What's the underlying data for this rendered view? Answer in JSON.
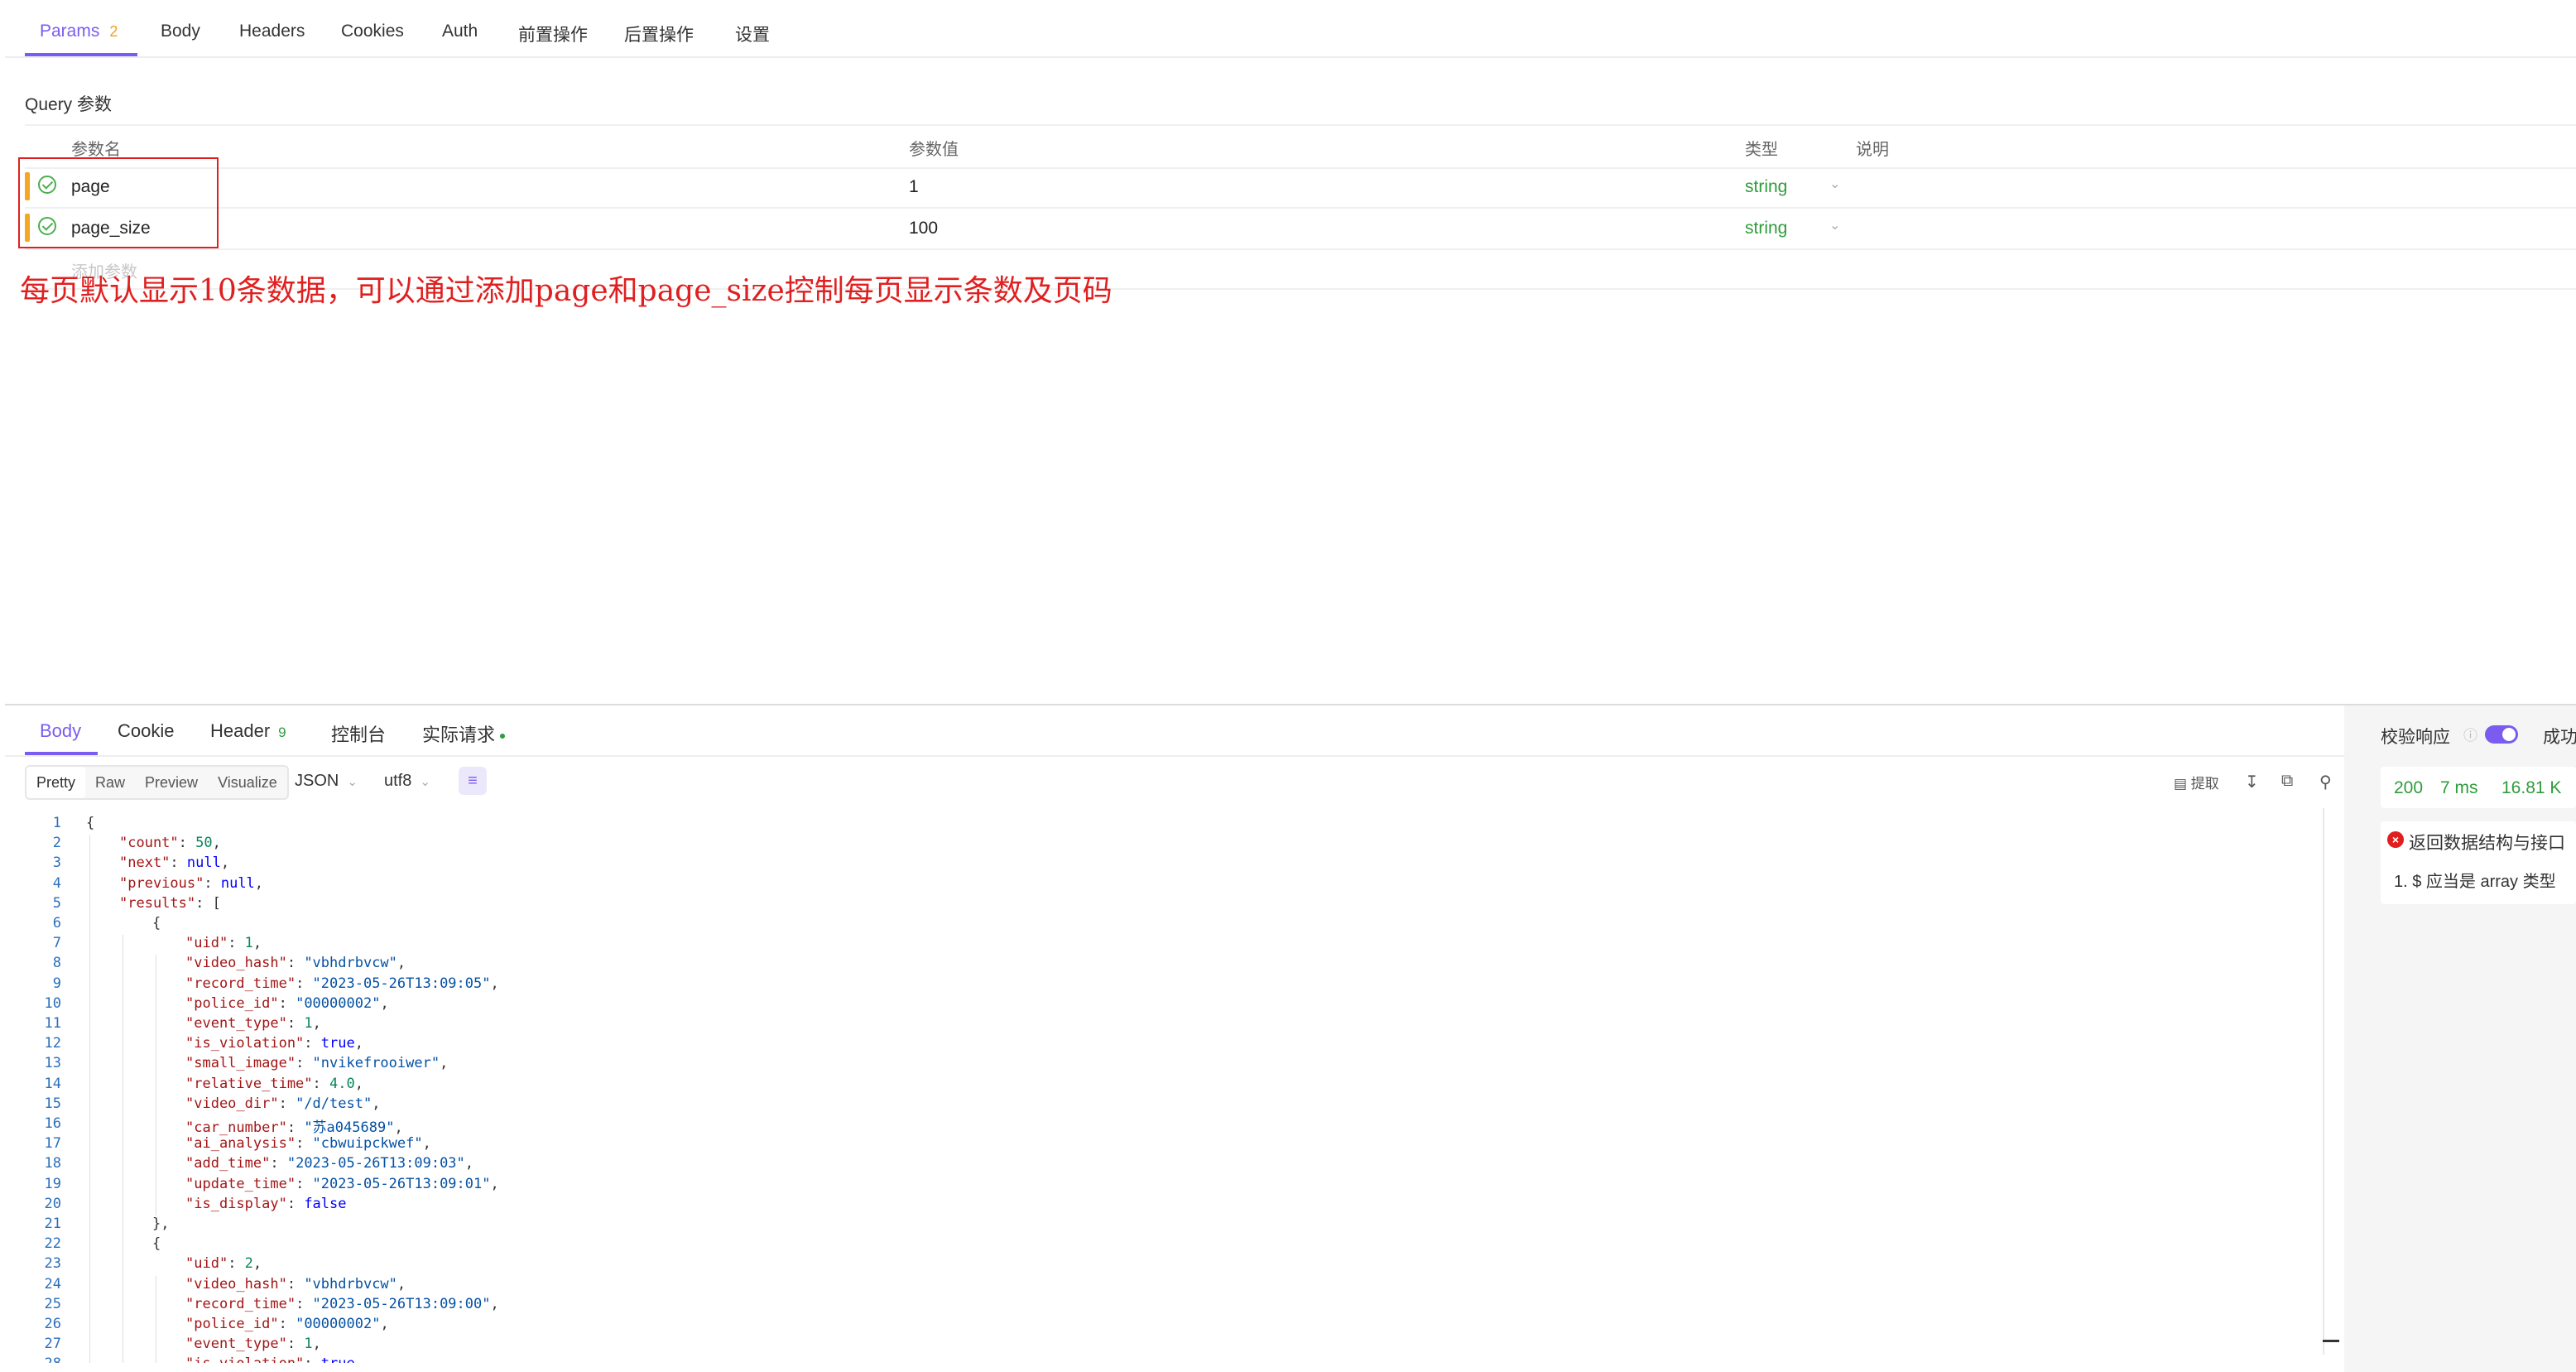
{
  "request_tabs": [
    {
      "label": "Params",
      "count": "2"
    },
    {
      "label": "Body"
    },
    {
      "label": "Headers"
    },
    {
      "label": "Cookies"
    },
    {
      "label": "Auth"
    },
    {
      "label": "前置操作"
    },
    {
      "label": "后置操作"
    },
    {
      "label": "设置"
    }
  ],
  "query": {
    "section_title": "Query 参数",
    "columns": [
      "参数名",
      "参数值",
      "类型",
      "说明"
    ],
    "rows": [
      {
        "name": "page",
        "value": "1",
        "type": "string"
      },
      {
        "name": "page_size",
        "value": "100",
        "type": "string"
      }
    ],
    "add_placeholder": "添加参数"
  },
  "annotation": "每页默认显示10条数据，可以通过添加page和page_size控制每页显示条数及页码",
  "response_tabs": [
    {
      "label": "Body"
    },
    {
      "label": "Cookie"
    },
    {
      "label": "Header",
      "count": "9"
    },
    {
      "label": "控制台"
    },
    {
      "label": "实际请求"
    }
  ],
  "view_modes": [
    "Pretty",
    "Raw",
    "Preview",
    "Visualize"
  ],
  "format_select": "JSON",
  "encoding_select": "utf8",
  "extract_label": "提取",
  "code_lines": [
    {
      "ln": "1",
      "t": "{",
      "i": 0
    },
    {
      "ln": "2",
      "t": "\"count\": 50,",
      "i": 1
    },
    {
      "ln": "3",
      "t": "\"next\": null,",
      "i": 1
    },
    {
      "ln": "4",
      "t": "\"previous\": null,",
      "i": 1
    },
    {
      "ln": "5",
      "t": "\"results\": [",
      "i": 1
    },
    {
      "ln": "6",
      "t": "{",
      "i": 2
    },
    {
      "ln": "7",
      "t": "\"uid\": 1,",
      "i": 3
    },
    {
      "ln": "8",
      "t": "\"video_hash\": \"vbhdrbvcw\",",
      "i": 3
    },
    {
      "ln": "9",
      "t": "\"record_time\": \"2023-05-26T13:09:05\",",
      "i": 3
    },
    {
      "ln": "10",
      "t": "\"police_id\": \"00000002\",",
      "i": 3
    },
    {
      "ln": "11",
      "t": "\"event_type\": 1,",
      "i": 3
    },
    {
      "ln": "12",
      "t": "\"is_violation\": true,",
      "i": 3
    },
    {
      "ln": "13",
      "t": "\"small_image\": \"nvikefrooiwer\",",
      "i": 3
    },
    {
      "ln": "14",
      "t": "\"relative_time\": 4.0,",
      "i": 3
    },
    {
      "ln": "15",
      "t": "\"video_dir\": \"/d/test\",",
      "i": 3
    },
    {
      "ln": "16",
      "t": "\"car_number\": \"苏a045689\",",
      "i": 3
    },
    {
      "ln": "17",
      "t": "\"ai_analysis\": \"cbwuipckwef\",",
      "i": 3
    },
    {
      "ln": "18",
      "t": "\"add_time\": \"2023-05-26T13:09:03\",",
      "i": 3
    },
    {
      "ln": "19",
      "t": "\"update_time\": \"2023-05-26T13:09:01\",",
      "i": 3
    },
    {
      "ln": "20",
      "t": "\"is_display\": false",
      "i": 3
    },
    {
      "ln": "21",
      "t": "},",
      "i": 2
    },
    {
      "ln": "22",
      "t": "{",
      "i": 2
    },
    {
      "ln": "23",
      "t": "\"uid\": 2,",
      "i": 3
    },
    {
      "ln": "24",
      "t": "\"video_hash\": \"vbhdrbvcw\",",
      "i": 3
    },
    {
      "ln": "25",
      "t": "\"record_time\": \"2023-05-26T13:09:00\",",
      "i": 3
    },
    {
      "ln": "26",
      "t": "\"police_id\": \"00000002\",",
      "i": 3
    },
    {
      "ln": "27",
      "t": "\"event_type\": 1,",
      "i": 3
    },
    {
      "ln": "28",
      "t": "\"is_violation\": true,",
      "i": 3
    }
  ],
  "validation": {
    "label": "校验响应",
    "result_label": "成功",
    "status_code": "200",
    "time": "7 ms",
    "size": "16.81 K",
    "error_title": "返回数据结构与接口",
    "error_detail": "1. $ 应当是 array 类型"
  },
  "colors": {
    "accent": "#7a5cf0",
    "annotation": "#e02020",
    "param_drag": "#f5a623",
    "type_text": "#2e9c3a"
  }
}
